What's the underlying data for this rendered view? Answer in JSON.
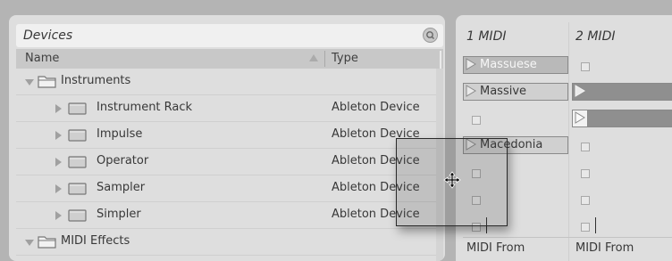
{
  "browser": {
    "title": "Devices",
    "columns": {
      "name": "Name",
      "type": "Type"
    },
    "items": [
      {
        "label": "Instruments",
        "type": "",
        "kind": "category",
        "expanded": true
      },
      {
        "label": "Instrument Rack",
        "type": "Ableton Device",
        "kind": "device"
      },
      {
        "label": "Impulse",
        "type": "Ableton Device",
        "kind": "device"
      },
      {
        "label": "Operator",
        "type": "Ableton Device",
        "kind": "device"
      },
      {
        "label": "Sampler",
        "type": "Ableton Device",
        "kind": "device"
      },
      {
        "label": "Simpler",
        "type": "Ableton Device",
        "kind": "device"
      },
      {
        "label": "MIDI Effects",
        "type": "",
        "kind": "category",
        "expanded": true
      }
    ]
  },
  "session": {
    "tracks": [
      {
        "name": "1 MIDI",
        "io_label": "MIDI From"
      },
      {
        "name": "2 MIDI",
        "io_label": "MIDI From"
      }
    ],
    "clips": {
      "track1": [
        "Massuese",
        "Massive",
        "",
        "Macedonia",
        "",
        "",
        ""
      ],
      "track2": [
        "",
        "",
        "",
        "",
        "",
        "",
        ""
      ]
    }
  },
  "colors": {
    "clip_fill": "#b9b9b9",
    "clip_selected": "#8f8f8f",
    "panel": "#dedede",
    "background": "#b4b4b4"
  }
}
